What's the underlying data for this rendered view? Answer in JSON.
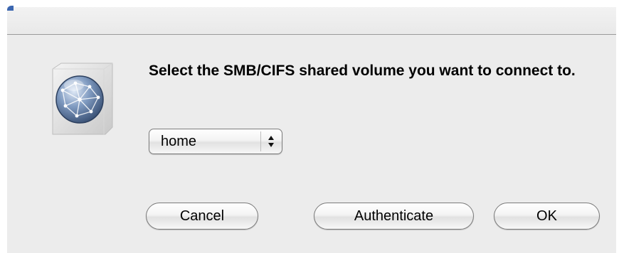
{
  "dialog": {
    "message": "Select the SMB/CIFS shared volume you want to connect to.",
    "icon": "network-globe-icon"
  },
  "volume_popup": {
    "selected": "home"
  },
  "buttons": {
    "cancel": "Cancel",
    "authenticate": "Authenticate",
    "ok": "OK"
  }
}
